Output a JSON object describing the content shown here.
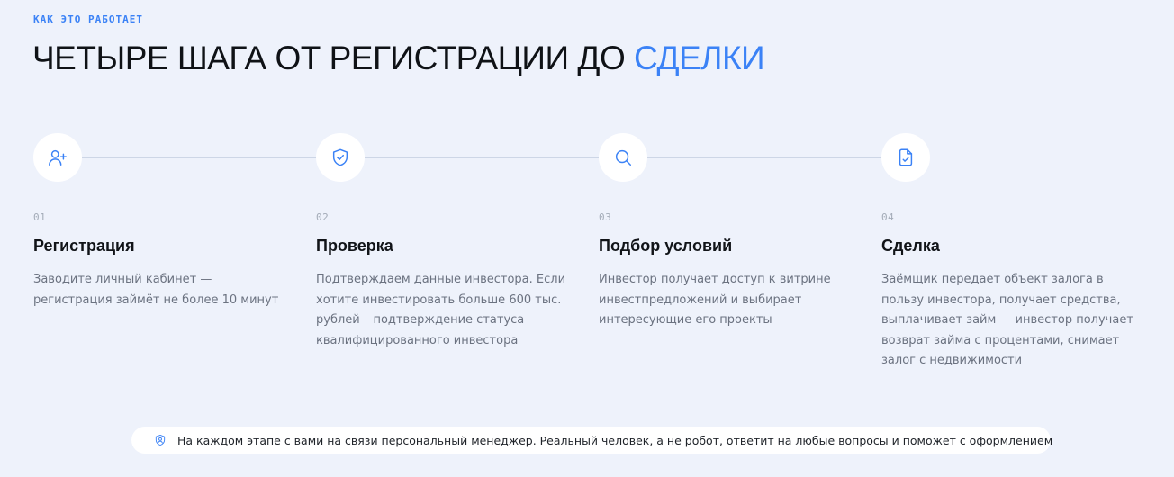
{
  "section": {
    "eyebrow": "КАК ЭТО РАБОТАЕТ",
    "title_main": "ЧЕТЫРЕ ШАГА ОТ РЕГИСТРАЦИИ ДО ",
    "title_accent": "СДЕЛКИ"
  },
  "steps": [
    {
      "icon": "user-plus-icon",
      "number": "01",
      "title": "Регистрация",
      "text": "Заводите личный кабинет — регистрация займёт не более 10 минут"
    },
    {
      "icon": "shield-check-icon",
      "number": "02",
      "title": "Проверка",
      "text": "Подтверждаем данные инвестора. Если хотите инвестировать больше 600 тыс. рублей – подтверждение статуса квалифицированного инвестора"
    },
    {
      "icon": "search-icon",
      "number": "03",
      "title": "Подбор условий",
      "text": "Инвестор получает доступ к витрине инвестпредложений и выбирает интересующие его проекты"
    },
    {
      "icon": "document-check-icon",
      "number": "04",
      "title": "Сделка",
      "text": "Заёмщик передает объект залога в пользу инвестора, получает средства, выплачивает займ — инвестор получает возврат займа с процентами, снимает залог с недвижимости"
    }
  ],
  "note": {
    "icon": "manager-shield-icon",
    "text": "На каждом этапе с вами на связи персональный менеджер. Реальный человек, а не робот, ответит на любые вопросы и поможет с оформлением"
  },
  "colors": {
    "accent": "#3b82f6",
    "background": "#eef2fb"
  }
}
